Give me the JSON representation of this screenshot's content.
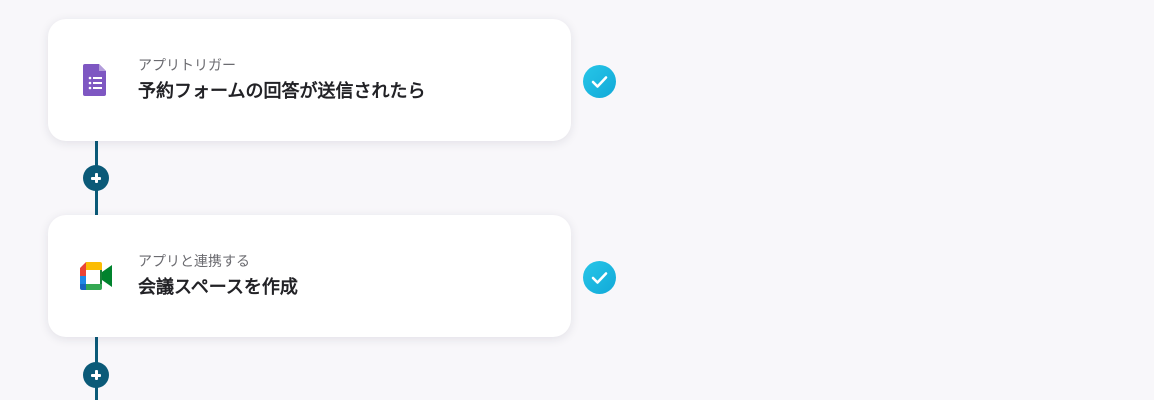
{
  "flow": {
    "steps": [
      {
        "label": "アプリトリガー",
        "title": "予約フォームの回答が送信されたら",
        "icon": "google-forms-icon",
        "icon_color": "#7e57c2",
        "status": "completed"
      },
      {
        "label": "アプリと連携する",
        "title": "会議スペースを作成",
        "icon": "google-meet-icon",
        "status": "completed"
      }
    ],
    "connector_color": "#0b5a78",
    "check_color": "#1ab5de"
  }
}
